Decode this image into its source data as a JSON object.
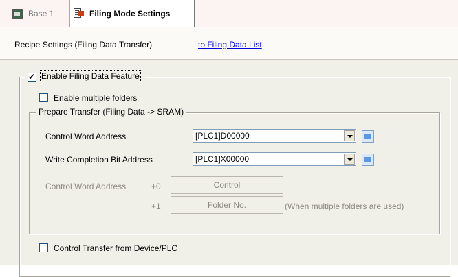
{
  "tabs": [
    {
      "label": "Base 1",
      "icon": "monitor-icon",
      "active": false
    },
    {
      "label": "Filing Mode Settings",
      "icon": "document-icon",
      "active": true
    }
  ],
  "header": {
    "title": "Recipe Settings (Filing Data Transfer)",
    "link": "to Filing Data List"
  },
  "filing": {
    "enable_label": "Enable Filing Data Feature",
    "enable_checked": true,
    "multi_label": "Enable multiple folders",
    "multi_checked": false,
    "prepare": {
      "legend": "Prepare Transfer (Filing Data -> SRAM)",
      "control_word_label": "Control Word Address",
      "control_word_value": "[PLC1]D00000",
      "write_completion_label": "Write Completion Bit Address",
      "write_completion_value": "[PLC1]X00000",
      "map_label": "Control Word Address",
      "rows": [
        {
          "offset": "+0",
          "name": "Control",
          "note": ""
        },
        {
          "offset": "+1",
          "name": "Folder No.",
          "note": "(When multiple folders are used)"
        }
      ]
    },
    "control_transfer_label": "Control Transfer from Device/PLC",
    "control_transfer_checked": false
  }
}
